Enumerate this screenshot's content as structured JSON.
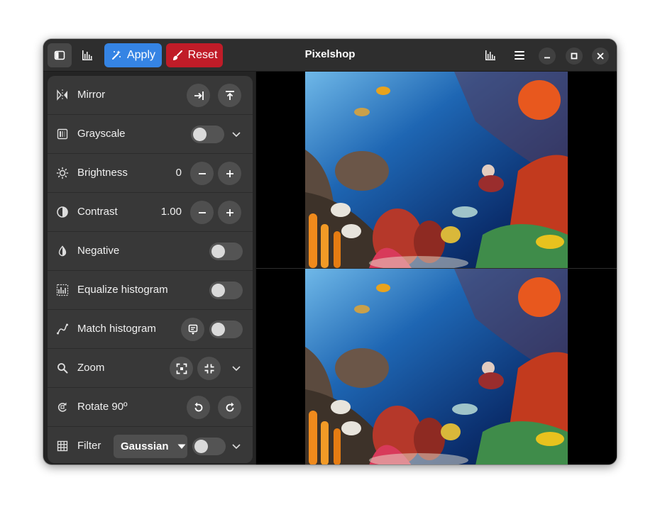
{
  "window": {
    "title": "Pixelshop"
  },
  "header": {
    "apply_label": "Apply",
    "reset_label": "Reset",
    "accent_color": "#3584e4",
    "destructive_color": "#c01c28"
  },
  "sidebar": {
    "rows": [
      {
        "label": "Mirror",
        "icon": "mirror-icon"
      },
      {
        "label": "Grayscale",
        "icon": "grayscale-icon",
        "switch_on": false
      },
      {
        "label": "Brightness",
        "icon": "brightness-icon",
        "value": "0"
      },
      {
        "label": "Contrast",
        "icon": "contrast-icon",
        "value": "1.00"
      },
      {
        "label": "Negative",
        "icon": "negative-icon",
        "switch_on": false
      },
      {
        "label": "Equalize histogram",
        "icon": "equalize-icon",
        "switch_on": false
      },
      {
        "label": "Match histogram",
        "icon": "match-histogram-icon",
        "switch_on": false
      },
      {
        "label": "Zoom",
        "icon": "magnifier-icon"
      },
      {
        "label": "Rotate 90º",
        "icon": "rotate-icon"
      },
      {
        "label": "Filter",
        "icon": "grid-icon",
        "selected": "Gaussian",
        "switch_on": false
      }
    ]
  },
  "viewer": {
    "images": [
      "original",
      "preview"
    ]
  }
}
